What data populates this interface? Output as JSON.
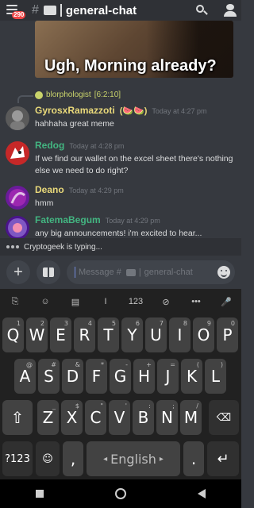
{
  "header": {
    "badge_count": "290",
    "hash": "#",
    "channel_title": "general-chat"
  },
  "meme": {
    "caption": "Ugh, Morning already?"
  },
  "reply": {
    "name": "blorphologist",
    "timestamp": "[6:2:10]"
  },
  "messages": [
    {
      "username": "GyrosxRamazzoti",
      "emoji": "(🍉🍉)",
      "time": "Today at 4:27 pm",
      "text": "hahhaha great meme",
      "color": "#e9d97a"
    },
    {
      "username": "Redog",
      "time": "Today at 4:28 pm",
      "text": "If we find our wallet on the excel sheet there's nothing else we need to do right?",
      "color": "#43b581"
    },
    {
      "username": "Deano",
      "time": "Today at 4:29 pm",
      "text": "hmm",
      "color": "#e9d97a"
    },
    {
      "username": "FatemaBegum",
      "time": "Today at 4:29 pm",
      "text": "any big announcements! i'm excited to hear...",
      "color": "#43b581"
    }
  ],
  "typing": {
    "text": "Cryptogeek is typing..."
  },
  "composer": {
    "placeholder_prefix": "Message #",
    "placeholder_channel": "general-chat"
  },
  "keyboard": {
    "toolbar": [
      "clip-icon",
      "emoji-icon",
      "clipboard-icon",
      "cursor-icon",
      "123",
      "no-image-icon",
      "more-icon",
      "mic-icon"
    ],
    "toolbar_numbers": "123",
    "row1": [
      {
        "k": "Q",
        "s": "1"
      },
      {
        "k": "W",
        "s": "2"
      },
      {
        "k": "E",
        "s": "3"
      },
      {
        "k": "R",
        "s": "4"
      },
      {
        "k": "T",
        "s": "5"
      },
      {
        "k": "Y",
        "s": "6"
      },
      {
        "k": "U",
        "s": "7"
      },
      {
        "k": "I",
        "s": "8"
      },
      {
        "k": "O",
        "s": "9"
      },
      {
        "k": "P",
        "s": "0"
      }
    ],
    "row2": [
      {
        "k": "A",
        "s": "@"
      },
      {
        "k": "S",
        "s": "#"
      },
      {
        "k": "D",
        "s": "&"
      },
      {
        "k": "F",
        "s": "*"
      },
      {
        "k": "G",
        "s": "-"
      },
      {
        "k": "H",
        "s": "+"
      },
      {
        "k": "J",
        "s": "="
      },
      {
        "k": "K",
        "s": "("
      },
      {
        "k": "L",
        "s": ")"
      }
    ],
    "row3": [
      {
        "k": "Z",
        "s": "_"
      },
      {
        "k": "X",
        "s": "$"
      },
      {
        "k": "C",
        "s": "\""
      },
      {
        "k": "V",
        "s": "'"
      },
      {
        "k": "B",
        "s": ":"
      },
      {
        "k": "N",
        "s": ";"
      },
      {
        "k": "M",
        "s": "/"
      }
    ],
    "symbols_label": "?123",
    "comma": ",",
    "space_label": "English",
    "period": "."
  },
  "colors": {
    "bg": "#36393f",
    "header": "#2f3136",
    "accent": "#7289da",
    "keyboard": "#212121"
  }
}
